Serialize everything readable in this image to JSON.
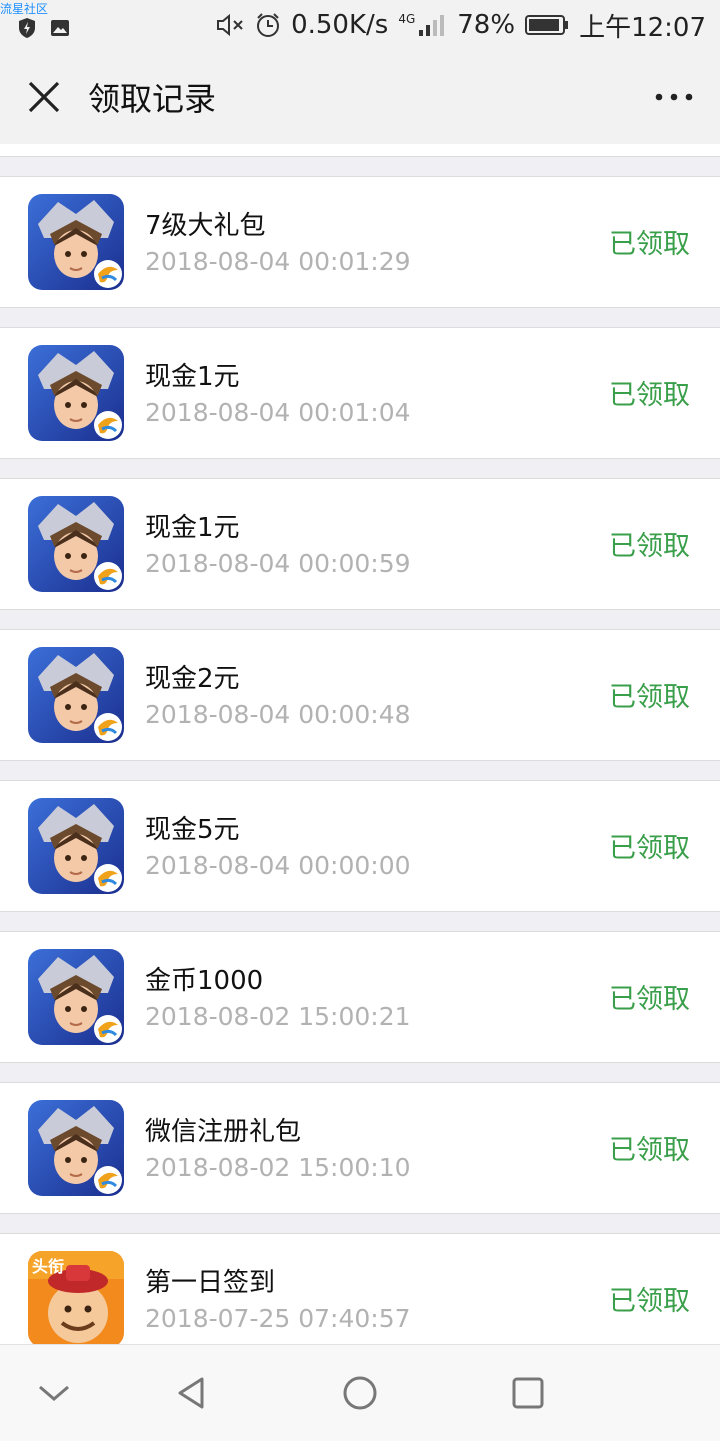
{
  "watermark": "流星社区",
  "status_bar": {
    "net_speed": "0.50K/s",
    "network_type": "4G",
    "battery": "78%",
    "time": "上午12:07"
  },
  "header": {
    "title": "领取记录",
    "close_icon": "close-icon",
    "more_icon": "more-icon"
  },
  "records": [
    {
      "name": "7级大礼包",
      "date": "2018-08-04 00:01:29",
      "status": "已领取",
      "icon": "saint-seiya-game-icon"
    },
    {
      "name": "现金1元",
      "date": "2018-08-04 00:01:04",
      "status": "已领取",
      "icon": "saint-seiya-game-icon"
    },
    {
      "name": "现金1元",
      "date": "2018-08-04 00:00:59",
      "status": "已领取",
      "icon": "saint-seiya-game-icon"
    },
    {
      "name": "现金2元",
      "date": "2018-08-04 00:00:48",
      "status": "已领取",
      "icon": "saint-seiya-game-icon"
    },
    {
      "name": "现金5元",
      "date": "2018-08-04 00:00:00",
      "status": "已领取",
      "icon": "saint-seiya-game-icon"
    },
    {
      "name": "金币1000",
      "date": "2018-08-02 15:00:21",
      "status": "已领取",
      "icon": "saint-seiya-game-icon"
    },
    {
      "name": "微信注册礼包",
      "date": "2018-08-02 15:00:10",
      "status": "已领取",
      "icon": "saint-seiya-game-icon"
    },
    {
      "name": "第一日签到",
      "date": "2018-07-25 07:40:57",
      "status": "已领取",
      "icon": "toutiao-game-icon",
      "icon_badge": "头衔"
    }
  ],
  "colors": {
    "status_green": "#3a9f4a",
    "date_gray": "#b2b2b2",
    "background": "#efeff4"
  }
}
